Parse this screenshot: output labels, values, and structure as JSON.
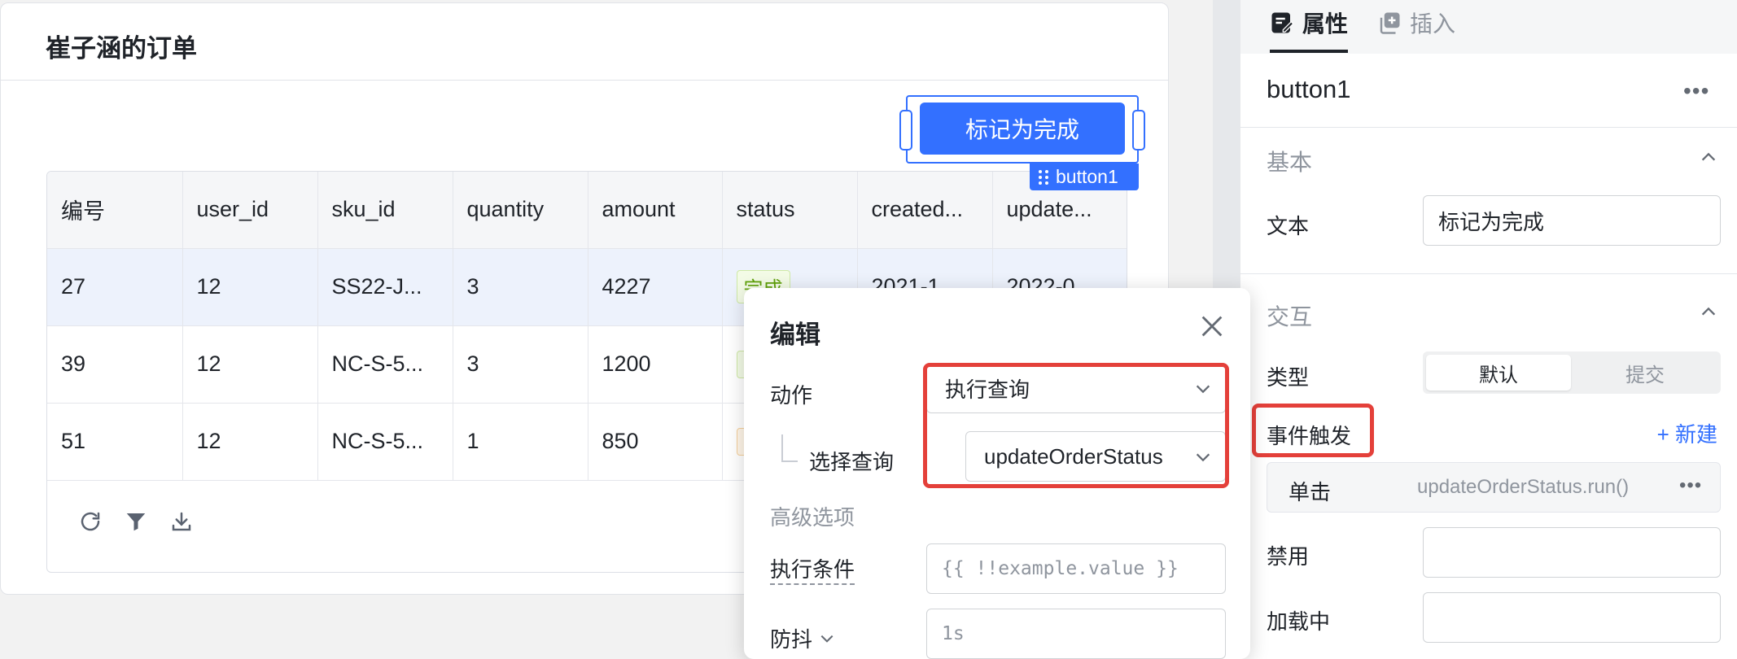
{
  "card": {
    "title": "崔子涵的订单",
    "button_label": "标记为完成",
    "button_tag": "button1"
  },
  "table": {
    "columns": [
      "编号",
      "user_id",
      "sku_id",
      "quantity",
      "amount",
      "status",
      "created...",
      "update..."
    ],
    "rows": [
      {
        "id": "27",
        "user_id": "12",
        "sku_id": "SS22-J...",
        "quantity": "3",
        "amount": "4227",
        "status": "完成",
        "created": "2021-1",
        "updated": "2022-0"
      },
      {
        "id": "39",
        "user_id": "12",
        "sku_id": "NC-S-5...",
        "quantity": "3",
        "amount": "1200",
        "status": "",
        "created": "",
        "updated": ""
      },
      {
        "id": "51",
        "user_id": "12",
        "sku_id": "NC-S-5...",
        "quantity": "1",
        "amount": "850",
        "status": "",
        "created": "",
        "updated": ""
      }
    ],
    "toolbar_icons": [
      "refresh-icon",
      "filter-icon",
      "download-icon"
    ]
  },
  "panel": {
    "tabs": [
      "属性",
      "插入"
    ],
    "component_name": "button1",
    "more": "•••",
    "basic": {
      "title": "基本",
      "text_label": "文本",
      "text_value": "标记为完成"
    },
    "interaction": {
      "title": "交互",
      "type_label": "类型",
      "type_options": [
        "默认",
        "提交"
      ],
      "event_label": "事件触发",
      "new_label": "+ 新建",
      "event_name": "单击",
      "event_value": "updateOrderStatus.run()",
      "disabled_label": "禁用",
      "loading_label": "加载中"
    }
  },
  "popover": {
    "title": "编辑",
    "action_label": "动作",
    "action_value": "执行查询",
    "query_label": "选择查询",
    "query_value": "updateOrderStatus",
    "advanced_label": "高级选项",
    "condition_label": "执行条件",
    "condition_placeholder": "{{ !!example.value }}",
    "debounce_label": "防抖",
    "debounce_value": "1s"
  },
  "colors": {
    "accent": "#3370ff",
    "highlight": "#e4403a",
    "selected_row": "#edf2fc"
  }
}
